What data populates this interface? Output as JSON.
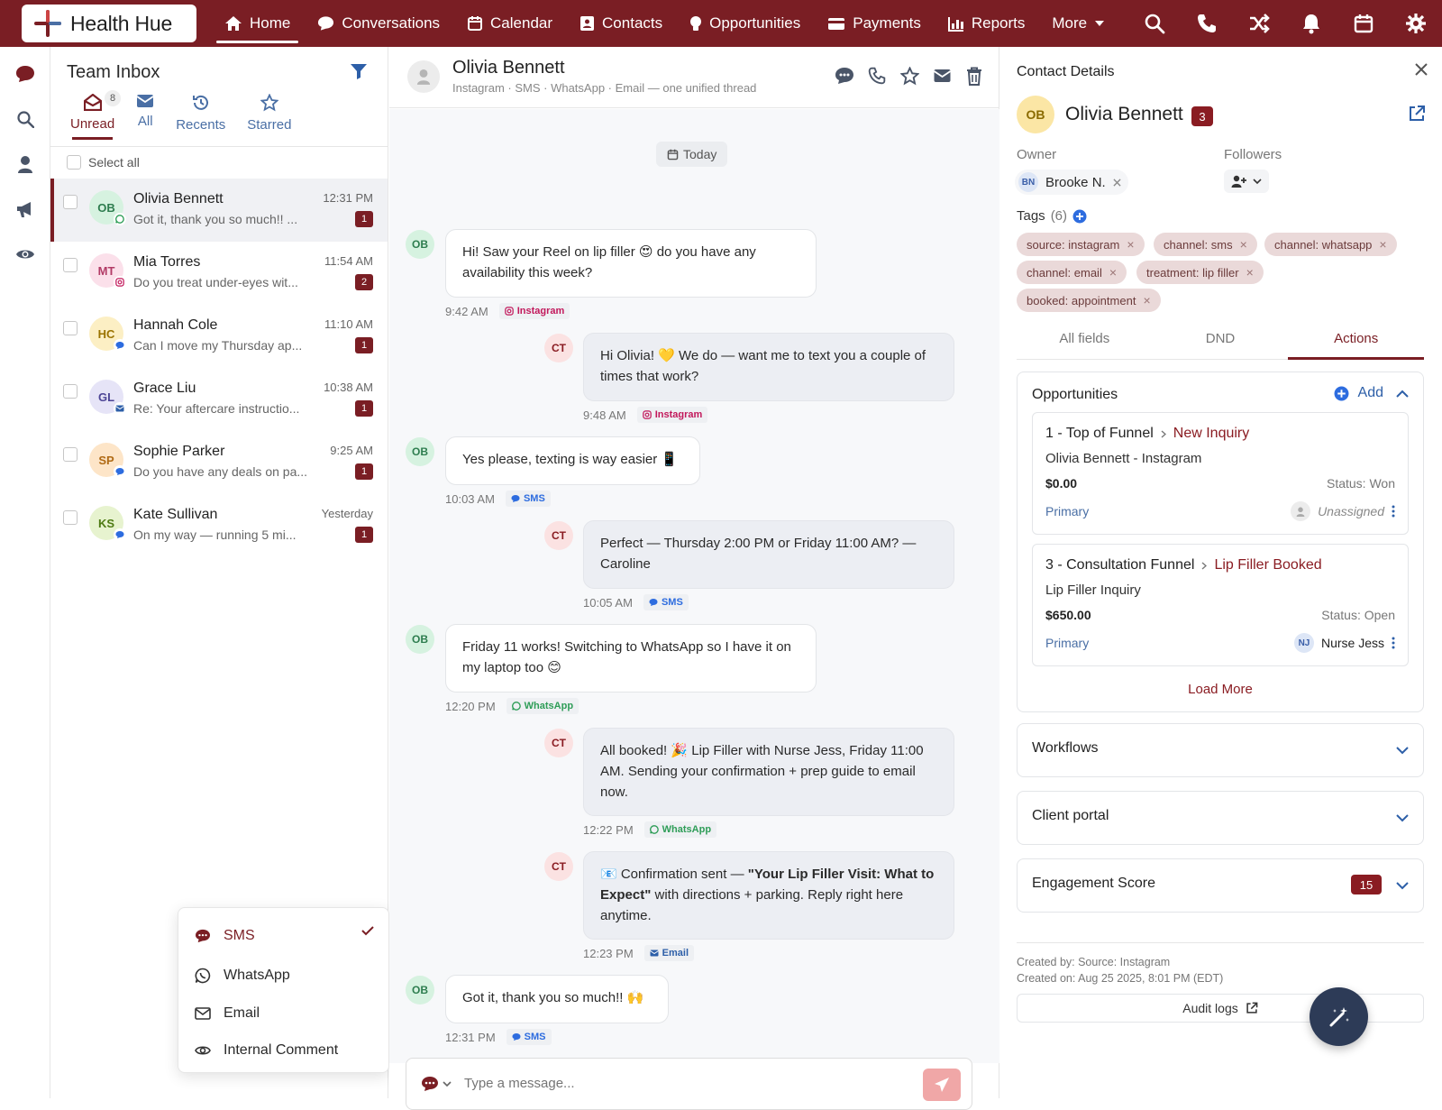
{
  "app": {
    "name": "Health Hue"
  },
  "nav": {
    "items": [
      {
        "label": "Home",
        "icon": "home-icon"
      },
      {
        "label": "Conversations",
        "icon": "chat-icon"
      },
      {
        "label": "Calendar",
        "icon": "calendar-icon"
      },
      {
        "label": "Contacts",
        "icon": "contacts-icon"
      },
      {
        "label": "Opportunities",
        "icon": "lightbulb-icon"
      },
      {
        "label": "Payments",
        "icon": "card-icon"
      },
      {
        "label": "Reports",
        "icon": "bar-chart-icon"
      },
      {
        "label": "More",
        "icon": "caret-down-icon"
      }
    ],
    "active_index": 0
  },
  "inbox": {
    "title": "Team Inbox",
    "tabs": [
      {
        "label": "Unread",
        "badge": "8"
      },
      {
        "label": "All"
      },
      {
        "label": "Recents"
      },
      {
        "label": "Starred"
      }
    ],
    "select_all": "Select all",
    "conversations": [
      {
        "initials": "OB",
        "name": "Olivia Bennett",
        "preview": "Got it, thank you so much!! ...",
        "time": "12:31 PM",
        "count": "1",
        "channel": "whatsapp",
        "avatar_bg": "#d6f2e0",
        "avatar_fg": "#2e7d4f"
      },
      {
        "initials": "MT",
        "name": "Mia Torres",
        "preview": "Do you treat under-eyes wit...",
        "time": "11:54 AM",
        "count": "2",
        "channel": "instagram",
        "avatar_bg": "#fbe0ea",
        "avatar_fg": "#b23b66"
      },
      {
        "initials": "HC",
        "name": "Hannah Cole",
        "preview": "Can I move my Thursday ap...",
        "time": "11:10 AM",
        "count": "1",
        "channel": "sms",
        "avatar_bg": "#fcefc4",
        "avatar_fg": "#9a7300"
      },
      {
        "initials": "GL",
        "name": "Grace Liu",
        "preview": "Re: Your aftercare instructio...",
        "time": "10:38 AM",
        "count": "1",
        "channel": "email",
        "avatar_bg": "#e6e4f7",
        "avatar_fg": "#4d4596"
      },
      {
        "initials": "SP",
        "name": "Sophie Parker",
        "preview": "Do you have any deals on pa...",
        "time": "9:25 AM",
        "count": "1",
        "channel": "sms",
        "avatar_bg": "#fde5c8",
        "avatar_fg": "#b06a14"
      },
      {
        "initials": "KS",
        "name": "Kate Sullivan",
        "preview": "On my way — running 5 mi...",
        "time": "Yesterday",
        "count": "1",
        "channel": "sms",
        "avatar_bg": "#e7f3cf",
        "avatar_fg": "#4d7a12"
      }
    ]
  },
  "channel_menu": {
    "items": [
      {
        "label": "SMS",
        "icon": "sms-icon",
        "selected": true
      },
      {
        "label": "WhatsApp",
        "icon": "whatsapp-icon"
      },
      {
        "label": "Email",
        "icon": "email-icon"
      },
      {
        "label": "Internal Comment",
        "icon": "eye-icon"
      }
    ]
  },
  "chat": {
    "contact_name": "Olivia Bennett",
    "subtitle": "Instagram · SMS · WhatsApp · Email — one unified thread",
    "date_divider": "Today",
    "messages": [
      {
        "from": "OB",
        "dir": "in",
        "text": "Hi! Saw your Reel on lip filler 😍 do you have any availability this week?",
        "time": "9:42 AM",
        "channel": "Instagram"
      },
      {
        "from": "CT",
        "dir": "out",
        "text": "Hi Olivia! 💛 We do — want me to text you a couple of times that work?",
        "time": "9:48 AM",
        "channel": "Instagram"
      },
      {
        "from": "OB",
        "dir": "in",
        "text": "Yes please, texting is way easier 📱",
        "time": "10:03 AM",
        "channel": "SMS"
      },
      {
        "from": "CT",
        "dir": "out",
        "text": "Perfect — Thursday 2:00 PM or Friday 11:00 AM? — Caroline",
        "time": "10:05 AM",
        "channel": "SMS"
      },
      {
        "from": "OB",
        "dir": "in",
        "text": "Friday 11 works! Switching to WhatsApp so I have it on my laptop too 😊",
        "time": "12:20 PM",
        "channel": "WhatsApp"
      },
      {
        "from": "CT",
        "dir": "out",
        "text": "All booked! 🎉 Lip Filler with Nurse Jess, Friday 11:00 AM. Sending your confirmation + prep guide to email now.",
        "time": "12:22 PM",
        "channel": "WhatsApp"
      },
      {
        "from": "CT",
        "dir": "out",
        "text_prefix": "📧 Confirmation sent — ",
        "text_bold": "\"Your Lip Filler Visit: What to Expect\"",
        "text_suffix": " with directions + parking. Reply right here anytime.",
        "time": "12:23 PM",
        "channel": "Email"
      },
      {
        "from": "OB",
        "dir": "in",
        "text": "Got it, thank you so much!! 🙌",
        "time": "12:31 PM",
        "channel": "SMS"
      }
    ],
    "composer_placeholder": "Type a message..."
  },
  "details": {
    "title": "Contact Details",
    "initials": "OB",
    "name": "Olivia Bennett",
    "badge": "3",
    "owner_label": "Owner",
    "followers_label": "Followers",
    "owner": {
      "initials": "BN",
      "name": "Brooke N."
    },
    "tags_label": "Tags",
    "tags_count": "(6)",
    "tags": [
      "source: instagram",
      "channel: sms",
      "channel: whatsapp",
      "channel: email",
      "treatment: lip filler",
      "booked: appointment"
    ],
    "tabs": [
      "All fields",
      "DND",
      "Actions"
    ],
    "active_tab": 2,
    "opportunities": {
      "title": "Opportunities",
      "add_label": "Add",
      "items": [
        {
          "pipeline": "1 - Top of Funnel",
          "stage": "New Inquiry",
          "name": "Olivia Bennett - Instagram",
          "amount": "$0.00",
          "status": "Status: Won",
          "primary": "Primary",
          "assignee": "Unassigned",
          "assignee_initials": ""
        },
        {
          "pipeline": "3 - Consultation Funnel",
          "stage": "Lip Filler Booked",
          "name": "Lip Filler Inquiry",
          "amount": "$650.00",
          "status": "Status: Open",
          "primary": "Primary",
          "assignee": "Nurse Jess",
          "assignee_initials": "NJ"
        }
      ],
      "load_more": "Load More"
    },
    "sections": [
      {
        "title": "Workflows"
      },
      {
        "title": "Client portal"
      },
      {
        "title": "Engagement Score",
        "badge": "15"
      }
    ],
    "created_by": "Created by: Source: Instagram",
    "created_on": "Created on: Aug 25 2025, 8:01 PM (EDT)",
    "audit_logs": "Audit logs"
  },
  "colors": {
    "brand": "#7a1e24",
    "badge": "#8a1c22",
    "link_blue": "#4a6fa5",
    "instagram": "#c2185b",
    "sms": "#2d6cdf",
    "whatsapp": "#2e9d57",
    "email": "#2d5fa8"
  }
}
